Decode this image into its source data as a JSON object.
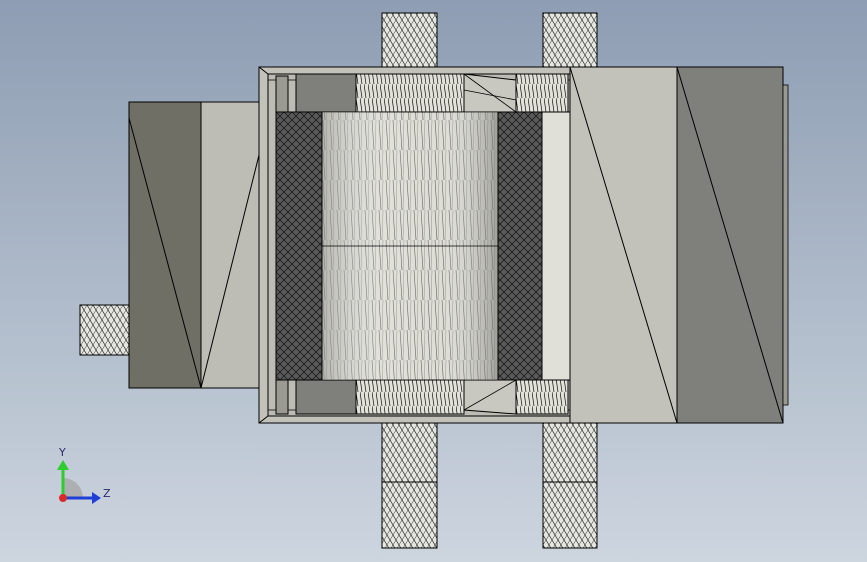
{
  "viewport": {
    "background_top": "#8e9db3",
    "background_bottom": "#cdd5df"
  },
  "model": {
    "body_color": "#bdbdb5",
    "dark_face_color": "#7f7f7c",
    "side_face_color": "#6f6f66",
    "roller_color": "#d8d8d0",
    "knurl_color": "#3a3a3a",
    "edge_color": "#000000"
  },
  "triad": {
    "y_label": "Y",
    "z_label": "Z",
    "y_color": "#2ecc2e",
    "z_color": "#1f3fd6",
    "x_color": "#d92b2b"
  }
}
